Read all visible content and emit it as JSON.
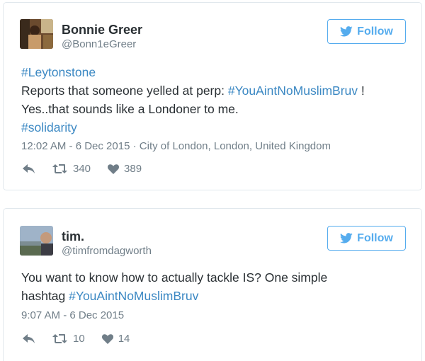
{
  "tweets": [
    {
      "name": "Bonnie Greer",
      "handle": "@Bonn1eGreer",
      "follow_label": "Follow",
      "lines": [
        [
          {
            "t": "#Leytonstone",
            "tag": true
          }
        ],
        [
          {
            "t": "Reports that someone yelled at perp: ",
            "tag": false
          },
          {
            "t": "#YouAintNoMuslimBruv",
            "tag": true
          },
          {
            "t": " !",
            "tag": false
          }
        ],
        [
          {
            "t": "Yes..that sounds like a  Londoner to me.",
            "tag": false
          }
        ],
        [
          {
            "t": "#solidarity",
            "tag": true
          }
        ]
      ],
      "timestamp": "12:02 AM - 6 Dec 2015",
      "location": "City of London, London, United Kingdom",
      "retweets": "340",
      "likes": "389"
    },
    {
      "name": "tim.",
      "handle": "@timfromdagworth",
      "follow_label": "Follow",
      "lines": [
        [
          {
            "t": "You want to know how to actually tackle IS? One simple",
            "tag": false
          }
        ],
        [
          {
            "t": "hashtag ",
            "tag": false
          },
          {
            "t": "#YouAintNoMuslimBruv",
            "tag": true
          }
        ]
      ],
      "timestamp": "9:07 AM - 6 Dec 2015",
      "location": "",
      "retweets": "10",
      "likes": "14"
    }
  ],
  "colors": {
    "link": "#3b88c3",
    "follow": "#55acee",
    "muted": "#707e88",
    "border": "#e1e8ed"
  },
  "icons": {
    "follow": "twitter-bird-icon",
    "reply": "reply-icon",
    "retweet": "retweet-icon",
    "like": "heart-icon"
  }
}
